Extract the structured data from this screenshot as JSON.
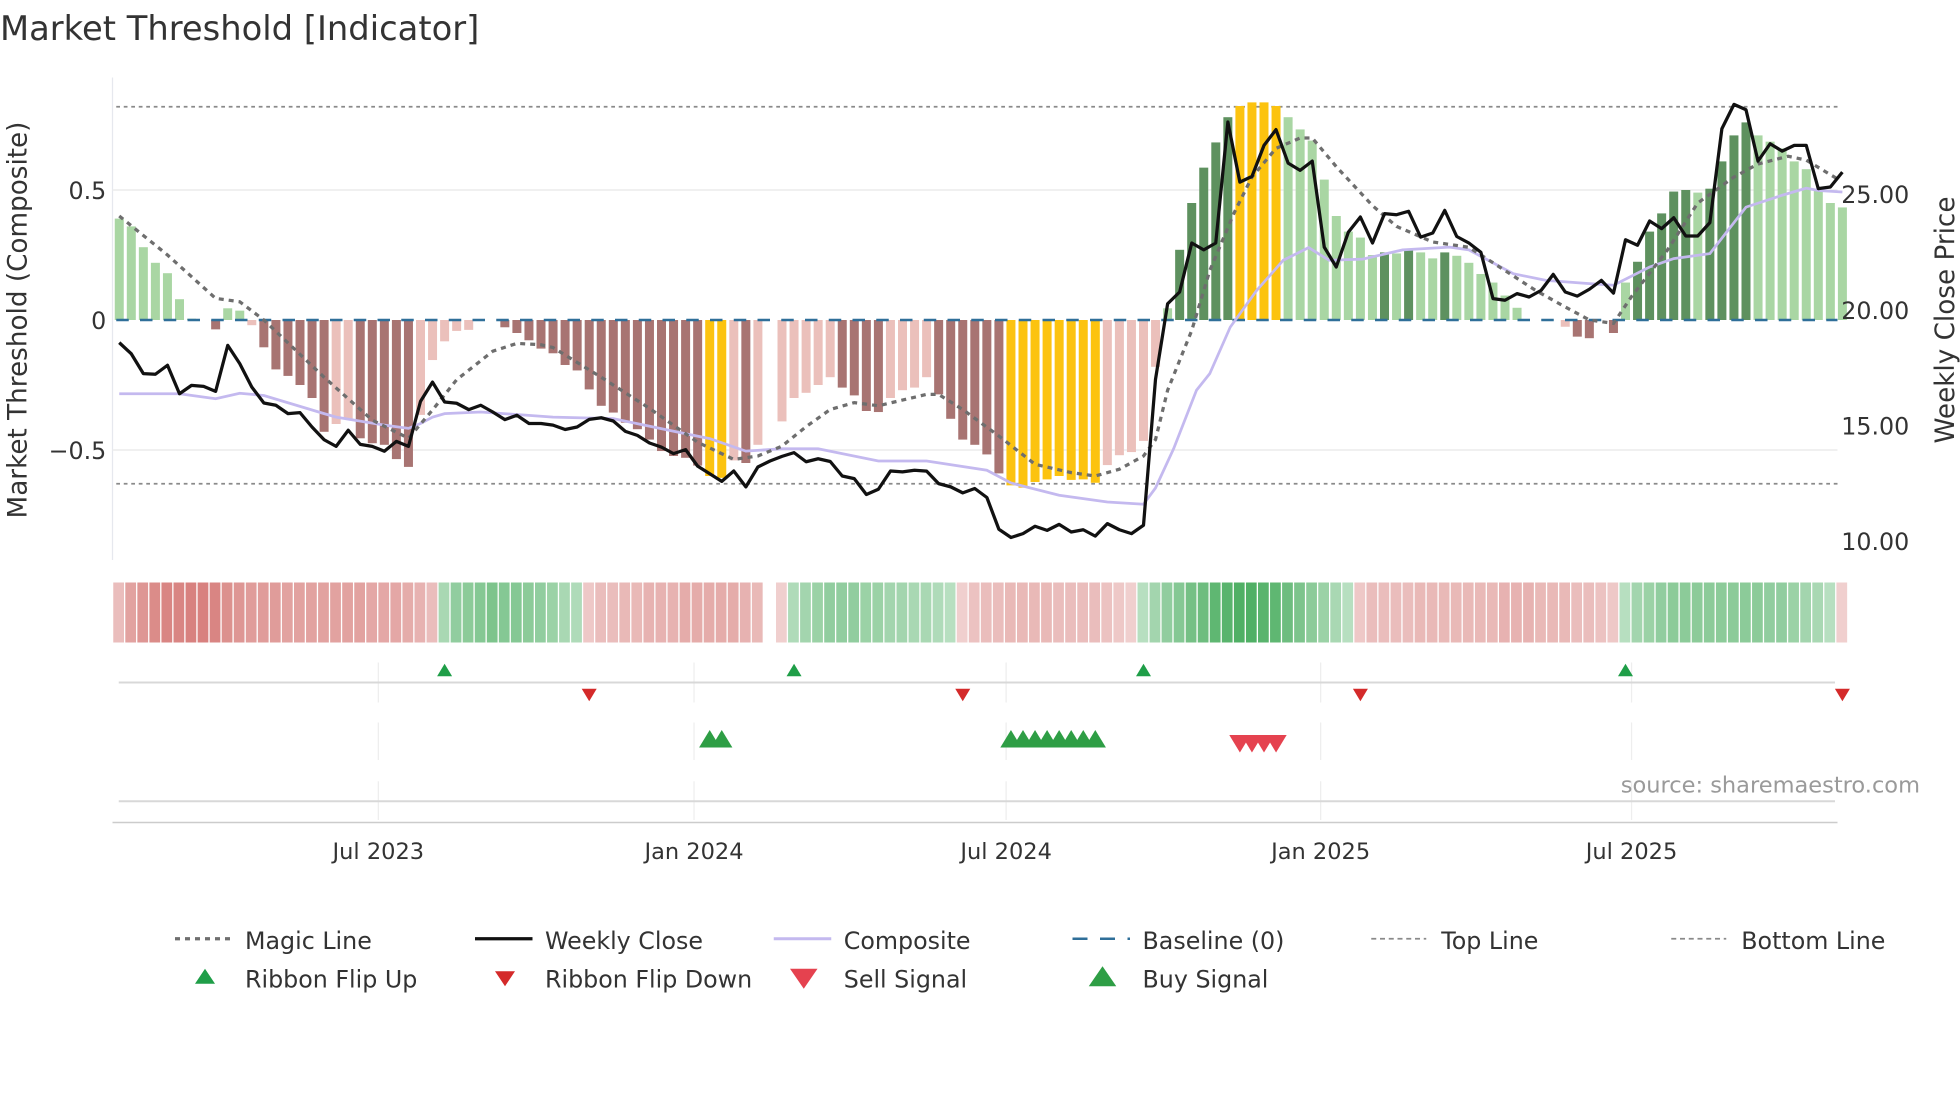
{
  "title": "Market Threshold [Indicator]",
  "source": "source: sharemaestro.com",
  "colors": {
    "light_green": "#a9d6a3",
    "dark_green": "#5e915f",
    "dark_red": "#a87472",
    "light_red": "#ebc0bb",
    "gold": "#fcc30f",
    "weekly_close": "#111111",
    "composite": "#c4b9ef",
    "magic": "#6e6e6e",
    "baseline": "#2f6f99",
    "threshold": "#8a8a8a",
    "flip_up": "#1f9e48",
    "flip_down": "#d42a2a",
    "buy": "#2e9e45",
    "sell": "#e5424f",
    "ribbon_red": "205,95,92",
    "ribbon_green": "45,160,70"
  },
  "chart_data": {
    "type": "bar+line",
    "title": "Market Threshold [Indicator]",
    "ylabel": "Market Threshold (Composite)",
    "y2label": "Weekly Close Price",
    "ylim": [
      -0.88,
      0.93
    ],
    "y2lim": [
      9,
      29
    ],
    "yticks": [
      {
        "v": 0.5,
        "label": "0.5"
      },
      {
        "v": 0,
        "label": "0"
      },
      {
        "v": -0.5,
        "label": "−0.5"
      }
    ],
    "y2ticks": [
      {
        "v": 25,
        "label": "25.00"
      },
      {
        "v": 20,
        "label": "20.00"
      },
      {
        "v": 15,
        "label": "15.00"
      },
      {
        "v": 10,
        "label": "10.00"
      }
    ],
    "xticks": [
      {
        "week": 21.5,
        "label": "Jul 2023"
      },
      {
        "week": 47.7,
        "label": "Jan 2024"
      },
      {
        "week": 73.6,
        "label": "Jul 2024"
      },
      {
        "week": 99.7,
        "label": "Jan 2025"
      },
      {
        "week": 125.5,
        "label": "Jul 2025"
      }
    ],
    "top_line": 0.82,
    "bottom_line": -0.63,
    "baseline": 0,
    "bars": {
      "values": [
        0.39,
        0.36,
        0.28,
        0.22,
        0.18,
        0.08,
        0.005,
        0,
        -0.036,
        0.045,
        0.036,
        -0.02,
        -0.105,
        -0.19,
        -0.215,
        -0.25,
        -0.3,
        -0.43,
        -0.4,
        -0.38,
        -0.455,
        -0.474,
        -0.48,
        -0.535,
        -0.565,
        -0.365,
        -0.154,
        -0.082,
        -0.042,
        -0.038,
        0,
        0,
        -0.028,
        -0.05,
        -0.078,
        -0.11,
        -0.128,
        -0.173,
        -0.194,
        -0.267,
        -0.33,
        -0.356,
        -0.395,
        -0.42,
        -0.46,
        -0.504,
        -0.523,
        -0.53,
        -0.56,
        -0.6,
        -0.607,
        -0.54,
        -0.55,
        -0.48,
        null,
        -0.39,
        -0.3,
        -0.28,
        -0.25,
        -0.22,
        -0.26,
        -0.29,
        -0.35,
        -0.354,
        -0.3,
        -0.27,
        -0.26,
        -0.22,
        -0.286,
        -0.38,
        -0.46,
        -0.48,
        -0.517,
        -0.59,
        -0.636,
        -0.645,
        -0.623,
        -0.613,
        -0.6,
        -0.615,
        -0.613,
        -0.626,
        -0.558,
        -0.52,
        -0.508,
        -0.465,
        -0.18,
        0.045,
        0.27,
        0.45,
        0.586,
        0.683,
        0.78,
        0.823,
        0.837,
        0.837,
        0.823,
        0.78,
        0.733,
        0.69,
        0.54,
        0.4,
        0.34,
        0.317,
        0.25,
        0.26,
        0.256,
        0.27,
        0.26,
        0.237,
        0.26,
        0.247,
        0.22,
        0.177,
        0.144,
        0.094,
        0.047,
        0,
        0,
        0,
        -0.026,
        -0.064,
        -0.07,
        0,
        -0.05,
        0.144,
        0.224,
        0.34,
        0.41,
        0.494,
        0.5,
        0.49,
        0.505,
        0.61,
        0.71,
        0.76,
        0.71,
        0.686,
        0.66,
        0.61,
        0.58,
        0.5,
        0.45,
        0.433
      ],
      "colors": [
        "lg",
        "lg",
        "lg",
        "lg",
        "lg",
        "lg",
        "lg",
        "lg",
        "dr",
        "lg",
        "lg",
        "lr",
        "dr",
        "dr",
        "dr",
        "dr",
        "dr",
        "dr",
        "lr",
        "lr",
        "dr",
        "dr",
        "dr",
        "dr",
        "dr",
        "lr",
        "lr",
        "lr",
        "lr",
        "lr",
        "lr",
        "lr",
        "dr",
        "dr",
        "dr",
        "dr",
        "dr",
        "dr",
        "dr",
        "dr",
        "dr",
        "dr",
        "dr",
        "dr",
        "dr",
        "dr",
        "dr",
        "dr",
        "dr",
        "gd",
        "gd",
        "lr",
        "dr",
        "lr",
        "lr",
        "lr",
        "lr",
        "lr",
        "lr",
        "lr",
        "dr",
        "dr",
        "dr",
        "dr",
        "lr",
        "lr",
        "lr",
        "lr",
        "dr",
        "dr",
        "dr",
        "dr",
        "dr",
        "dr",
        "gd",
        "gd",
        "gd",
        "gd",
        "gd",
        "gd",
        "gd",
        "gd",
        "lr",
        "lr",
        "lr",
        "lr",
        "lr",
        "lg",
        "dg",
        "dg",
        "dg",
        "dg",
        "dg",
        "gd",
        "gd",
        "gd",
        "gd",
        "lg",
        "lg",
        "lg",
        "lg",
        "lg",
        "lg",
        "lg",
        "lg",
        "dg",
        "lg",
        "dg",
        "lg",
        "lg",
        "dg",
        "lg",
        "lg",
        "lg",
        "lg",
        "lg",
        "lg",
        "lg",
        "lg",
        "lg",
        "lr",
        "dr",
        "dr",
        "dr",
        "dr",
        "lg",
        "dg",
        "dg",
        "dg",
        "dg",
        "dg",
        "lg",
        "dg",
        "dg",
        "dg",
        "dg",
        "lg",
        "lg",
        "lg",
        "lg",
        "lg",
        "lg",
        "lg",
        "lg"
      ]
    },
    "weekly_close": [
      18.59,
      18.11,
      17.25,
      17.22,
      17.61,
      16.38,
      16.74,
      16.7,
      16.48,
      18.47,
      17.68,
      16.67,
      15.98,
      15.88,
      15.52,
      15.56,
      14.94,
      14.39,
      14.1,
      14.8,
      14.19,
      14.1,
      13.89,
      14.32,
      14.1,
      16.05,
      16.88,
      16.02,
      15.97,
      15.69,
      15.88,
      15.59,
      15.26,
      15.45,
      15.09,
      15.09,
      15.02,
      14.83,
      14.94,
      15.27,
      15.34,
      15.2,
      14.75,
      14.58,
      14.25,
      14.07,
      13.79,
      13.96,
      13.25,
      12.92,
      12.59,
      13.04,
      12.35,
      13.21,
      13.47,
      13.67,
      13.83,
      13.44,
      13.57,
      13.45,
      12.82,
      12.71,
      12.02,
      12.25,
      13.04,
      13.0,
      13.07,
      13.03,
      12.49,
      12.35,
      12.09,
      12.28,
      11.89,
      10.52,
      10.16,
      10.33,
      10.65,
      10.47,
      10.73,
      10.4,
      10.5,
      10.22,
      10.76,
      10.5,
      10.33,
      10.69,
      17.0,
      20.27,
      20.78,
      22.9,
      22.6,
      22.9,
      28.13,
      25.53,
      25.78,
      27.12,
      27.8,
      26.35,
      26.04,
      26.44,
      22.72,
      21.86,
      23.37,
      24.02,
      22.9,
      24.17,
      24.12,
      24.27,
      23.15,
      23.33,
      24.31,
      23.18,
      22.9,
      22.5,
      20.49,
      20.42,
      20.71,
      20.56,
      20.85,
      21.54,
      20.78,
      20.6,
      20.9,
      21.28,
      20.73,
      23.04,
      22.8,
      23.85,
      23.52,
      23.99,
      23.2,
      23.2,
      23.78,
      27.84,
      28.89,
      28.66,
      26.44,
      27.19,
      26.87,
      27.12,
      27.12,
      25.25,
      25.32,
      25.96
    ],
    "composite": [
      [
        0,
        16.38
      ],
      [
        5,
        16.38
      ],
      [
        8,
        16.16
      ],
      [
        10,
        16.4
      ],
      [
        12,
        16.3
      ],
      [
        17,
        15.52
      ],
      [
        18,
        15.37
      ],
      [
        22,
        15.02
      ],
      [
        24,
        14.88
      ],
      [
        25,
        15.09
      ],
      [
        26,
        15.37
      ],
      [
        27,
        15.52
      ],
      [
        30,
        15.59
      ],
      [
        36,
        15.37
      ],
      [
        41,
        15.3
      ],
      [
        47,
        14.65
      ],
      [
        49,
        14.44
      ],
      [
        52,
        13.9
      ],
      [
        55,
        14.0
      ],
      [
        58,
        14.0
      ],
      [
        63,
        13.47
      ],
      [
        67,
        13.47
      ],
      [
        72,
        13.07
      ],
      [
        74,
        12.52
      ],
      [
        78,
        11.99
      ],
      [
        82,
        11.7
      ],
      [
        85,
        11.6
      ],
      [
        86,
        12.3
      ],
      [
        87.5,
        14.0
      ],
      [
        89.4,
        16.53
      ],
      [
        90.5,
        17.25
      ],
      [
        92.2,
        19.26
      ],
      [
        94.4,
        20.85
      ],
      [
        96.6,
        22.15
      ],
      [
        98.7,
        22.7
      ],
      [
        100.4,
        22.15
      ],
      [
        103.2,
        22.2
      ],
      [
        106.5,
        22.6
      ],
      [
        110.4,
        22.72
      ],
      [
        112,
        22.6
      ],
      [
        115.7,
        21.57
      ],
      [
        118.4,
        21.28
      ],
      [
        122,
        21.14
      ],
      [
        124,
        21.07
      ],
      [
        127,
        21.86
      ],
      [
        129,
        22.22
      ],
      [
        132,
        22.44
      ],
      [
        135,
        24.45
      ],
      [
        138,
        24.96
      ],
      [
        140,
        25.27
      ],
      [
        141,
        25.17
      ],
      [
        143,
        25.1
      ]
    ],
    "magic_line": [
      [
        0,
        0.4
      ],
      [
        4,
        0.25
      ],
      [
        8,
        0.083
      ],
      [
        10,
        0.07
      ],
      [
        12,
        0
      ],
      [
        17,
        -0.22
      ],
      [
        21,
        -0.385
      ],
      [
        24,
        -0.455
      ],
      [
        26,
        -0.346
      ],
      [
        28,
        -0.23
      ],
      [
        31,
        -0.12
      ],
      [
        33,
        -0.09
      ],
      [
        35,
        -0.095
      ],
      [
        36,
        -0.106
      ],
      [
        40,
        -0.22
      ],
      [
        44,
        -0.34
      ],
      [
        48,
        -0.47
      ],
      [
        51,
        -0.536
      ],
      [
        53,
        -0.523
      ],
      [
        55,
        -0.485
      ],
      [
        57,
        -0.41
      ],
      [
        59,
        -0.344
      ],
      [
        61,
        -0.318
      ],
      [
        63,
        -0.33
      ],
      [
        67,
        -0.286
      ],
      [
        68,
        -0.286
      ],
      [
        70,
        -0.344
      ],
      [
        73,
        -0.446
      ],
      [
        76,
        -0.555
      ],
      [
        79,
        -0.587
      ],
      [
        81,
        -0.6
      ],
      [
        83,
        -0.574
      ],
      [
        85,
        -0.523
      ],
      [
        86,
        -0.46
      ],
      [
        87,
        -0.27
      ],
      [
        89,
        -0.04
      ],
      [
        90.5,
        0.19
      ],
      [
        92.5,
        0.41
      ],
      [
        94,
        0.55
      ],
      [
        96,
        0.66
      ],
      [
        98,
        0.7
      ],
      [
        99,
        0.7
      ],
      [
        101,
        0.59
      ],
      [
        104,
        0.44
      ],
      [
        106,
        0.36
      ],
      [
        109,
        0.3
      ],
      [
        112,
        0.28
      ],
      [
        114,
        0.22
      ],
      [
        117.5,
        0.115
      ],
      [
        120,
        0.05
      ],
      [
        122,
        0
      ],
      [
        124,
        -0.013
      ],
      [
        125.5,
        0.09
      ],
      [
        128.5,
        0.27
      ],
      [
        131,
        0.45
      ],
      [
        134,
        0.55
      ],
      [
        136,
        0.6
      ],
      [
        138.5,
        0.63
      ],
      [
        140,
        0.615
      ],
      [
        142.5,
        0.545
      ]
    ],
    "ribbon": [
      -0.3,
      -0.55,
      -0.65,
      -0.75,
      -0.8,
      -0.8,
      -0.85,
      -0.85,
      -0.8,
      -0.7,
      -0.65,
      -0.6,
      -0.6,
      -0.6,
      -0.55,
      -0.55,
      -0.55,
      -0.55,
      -0.55,
      -0.55,
      -0.55,
      -0.5,
      -0.5,
      -0.5,
      -0.45,
      -0.4,
      -0.3,
      0.3,
      0.45,
      0.5,
      0.55,
      0.6,
      0.55,
      0.55,
      0.5,
      0.45,
      0.4,
      0.3,
      0.25,
      -0.2,
      -0.3,
      -0.3,
      -0.35,
      -0.35,
      -0.4,
      -0.4,
      -0.4,
      -0.45,
      -0.45,
      -0.45,
      -0.45,
      -0.45,
      -0.4,
      -0.35,
      null,
      -0.15,
      0.25,
      0.35,
      0.4,
      0.45,
      0.45,
      0.45,
      0.4,
      0.4,
      0.35,
      0.35,
      0.3,
      0.3,
      0.25,
      0.2,
      -0.15,
      -0.25,
      -0.3,
      -0.3,
      -0.35,
      -0.35,
      -0.35,
      -0.35,
      -0.3,
      -0.3,
      -0.3,
      -0.3,
      -0.25,
      -0.2,
      -0.15,
      0.2,
      0.35,
      0.45,
      0.55,
      0.65,
      0.7,
      0.8,
      0.85,
      0.9,
      0.9,
      0.85,
      0.8,
      0.7,
      0.6,
      0.5,
      0.4,
      0.3,
      0.2,
      -0.2,
      -0.3,
      -0.3,
      -0.3,
      -0.3,
      -0.35,
      -0.35,
      -0.35,
      -0.35,
      -0.35,
      -0.35,
      -0.35,
      -0.4,
      -0.4,
      -0.4,
      -0.35,
      -0.35,
      -0.35,
      -0.3,
      -0.3,
      -0.25,
      -0.2,
      0.2,
      0.35,
      0.4,
      0.45,
      0.5,
      0.5,
      0.5,
      0.5,
      0.5,
      0.5,
      0.5,
      0.5,
      0.45,
      0.45,
      0.4,
      0.35,
      0.3,
      0.2,
      -0.15
    ],
    "ribbon_flip_up": [
      27,
      56,
      85,
      125
    ],
    "ribbon_flip_down": [
      39,
      70,
      103,
      143
    ],
    "buy_signals": [
      49,
      50,
      74,
      75,
      76,
      77,
      78,
      79,
      80,
      81
    ],
    "sell_signals": [
      93,
      94,
      95,
      96
    ],
    "legend": [
      {
        "key": "magic",
        "label": "Magic Line"
      },
      {
        "key": "close",
        "label": "Weekly Close"
      },
      {
        "key": "composite",
        "label": "Composite"
      },
      {
        "key": "baseline",
        "label": "Baseline (0)"
      },
      {
        "key": "top",
        "label": "Top Line"
      },
      {
        "key": "bottom",
        "label": "Bottom Line"
      },
      {
        "key": "flipup",
        "label": "Ribbon Flip Up"
      },
      {
        "key": "flipdown",
        "label": "Ribbon Flip Down"
      },
      {
        "key": "sell",
        "label": "Sell Signal"
      },
      {
        "key": "buy",
        "label": "Buy Signal"
      }
    ],
    "legend_placement": "bottom"
  }
}
